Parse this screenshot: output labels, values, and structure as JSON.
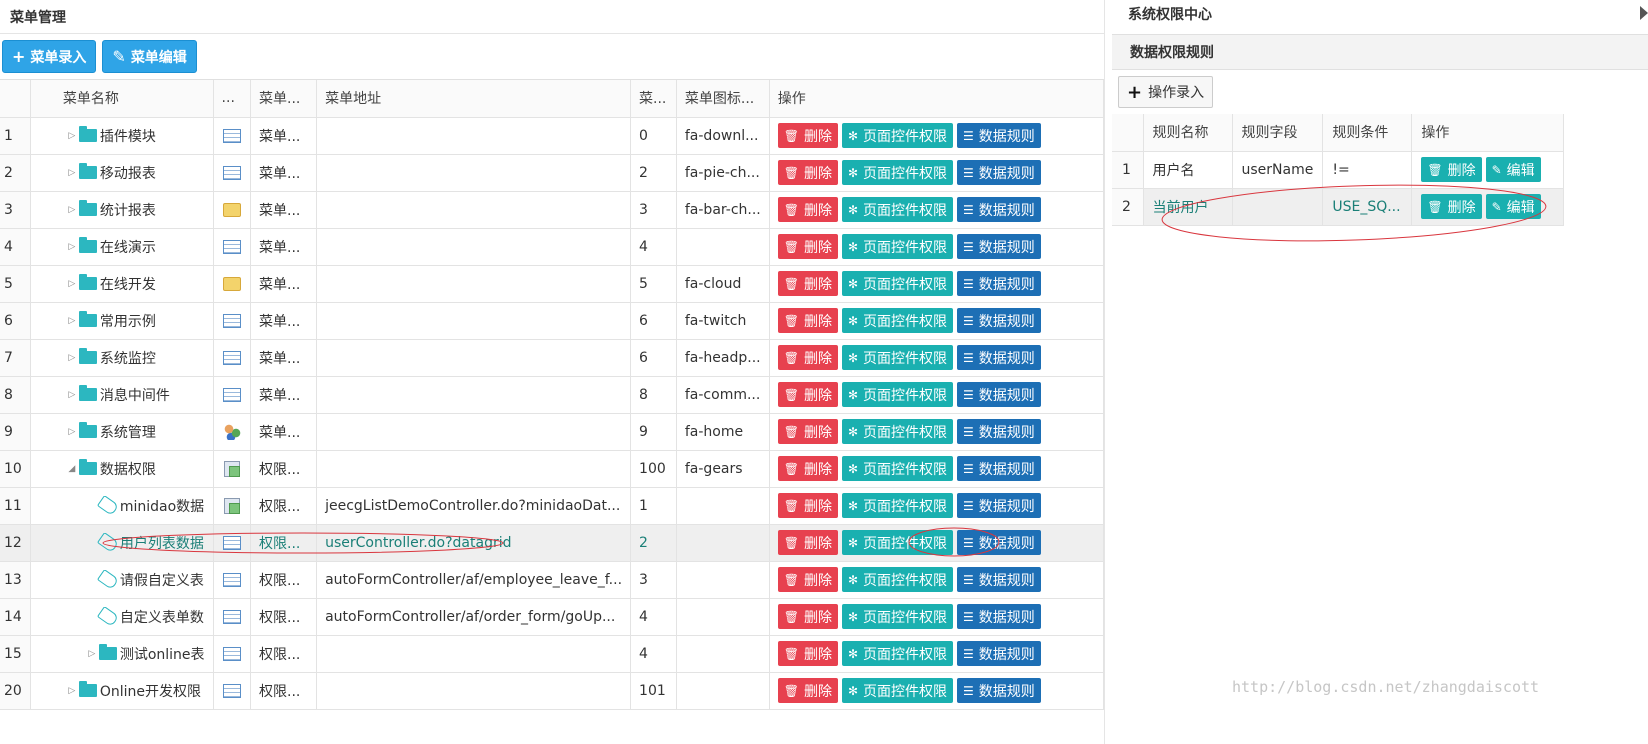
{
  "left_panel": {
    "title": "菜单管理",
    "toolbar": {
      "add_label": "菜单录入",
      "edit_label": "菜单编辑"
    },
    "columns": [
      "",
      "菜单名称",
      "...",
      "菜单...",
      "菜单地址",
      "菜...",
      "菜单图标...",
      "操作"
    ],
    "action_labels": {
      "delete": "删除",
      "page_perm": "页面控件权限",
      "data_rule": "数据规则"
    },
    "rows": [
      {
        "no": "1",
        "name": "插件模块",
        "level": 0,
        "expander": "▷",
        "node": "folder",
        "icon": "table",
        "type": "菜单...",
        "url": "",
        "order": "0",
        "icon_name": "fa-downl..."
      },
      {
        "no": "2",
        "name": "移动报表",
        "level": 0,
        "expander": "▷",
        "node": "folder",
        "icon": "table",
        "type": "菜单...",
        "url": "",
        "order": "2",
        "icon_name": "fa-pie-ch..."
      },
      {
        "no": "3",
        "name": "统计报表",
        "level": 0,
        "expander": "▷",
        "node": "folder",
        "icon": "folder",
        "type": "菜单...",
        "url": "",
        "order": "3",
        "icon_name": "fa-bar-ch..."
      },
      {
        "no": "4",
        "name": "在线演示",
        "level": 0,
        "expander": "▷",
        "node": "folder",
        "icon": "table",
        "type": "菜单...",
        "url": "",
        "order": "4",
        "icon_name": ""
      },
      {
        "no": "5",
        "name": "在线开发",
        "level": 0,
        "expander": "▷",
        "node": "folder",
        "icon": "folder",
        "type": "菜单...",
        "url": "",
        "order": "5",
        "icon_name": "fa-cloud"
      },
      {
        "no": "6",
        "name": "常用示例",
        "level": 0,
        "expander": "▷",
        "node": "folder",
        "icon": "table",
        "type": "菜单...",
        "url": "",
        "order": "6",
        "icon_name": "fa-twitch"
      },
      {
        "no": "7",
        "name": "系统监控",
        "level": 0,
        "expander": "▷",
        "node": "folder",
        "icon": "table",
        "type": "菜单...",
        "url": "",
        "order": "6",
        "icon_name": "fa-headp..."
      },
      {
        "no": "8",
        "name": "消息中间件",
        "level": 0,
        "expander": "▷",
        "node": "folder",
        "icon": "table",
        "type": "菜单...",
        "url": "",
        "order": "8",
        "icon_name": "fa-comm..."
      },
      {
        "no": "9",
        "name": "系统管理",
        "level": 0,
        "expander": "▷",
        "node": "folder",
        "icon": "users",
        "type": "菜单...",
        "url": "",
        "order": "9",
        "icon_name": "fa-home"
      },
      {
        "no": "10",
        "name": "数据权限",
        "level": 0,
        "expander": "◢",
        "node": "folder",
        "icon": "copy",
        "type": "权限...",
        "url": "",
        "order": "100",
        "icon_name": "fa-gears"
      },
      {
        "no": "11",
        "name": "minidao数据",
        "level": 1,
        "expander": "",
        "node": "tag",
        "icon": "copy",
        "type": "权限...",
        "url": "jeecgListDemoController.do?minidaoDat...",
        "order": "1",
        "icon_name": ""
      },
      {
        "no": "12",
        "name": "用户列表数据",
        "level": 1,
        "expander": "",
        "node": "tag",
        "icon": "table",
        "type": "权限...",
        "url": "userController.do?datagrid",
        "order": "2",
        "icon_name": "",
        "selected": true
      },
      {
        "no": "13",
        "name": "请假自定义表",
        "level": 1,
        "expander": "",
        "node": "tag",
        "icon": "table",
        "type": "权限...",
        "url": "autoFormController/af/employee_leave_f...",
        "order": "3",
        "icon_name": ""
      },
      {
        "no": "14",
        "name": "自定义表单数",
        "level": 1,
        "expander": "",
        "node": "tag",
        "icon": "table",
        "type": "权限...",
        "url": "autoFormController/af/order_form/goUp...",
        "order": "4",
        "icon_name": ""
      },
      {
        "no": "15",
        "name": "测试online表",
        "level": 1,
        "expander": "▷",
        "node": "folder",
        "icon": "table",
        "type": "权限...",
        "url": "",
        "order": "4",
        "icon_name": ""
      },
      {
        "no": "20",
        "name": "Online开发权限",
        "level": 0,
        "expander": "▷",
        "node": "folder",
        "icon": "table",
        "type": "权限...",
        "url": "",
        "order": "101",
        "icon_name": ""
      }
    ]
  },
  "right_panel": {
    "title": "系统权限中心",
    "subtitle": "数据权限规则",
    "add_label": "操作录入",
    "columns": [
      "",
      "规则名称",
      "规则字段",
      "规则条件",
      "操作"
    ],
    "action_labels": {
      "delete": "删除",
      "edit": "编辑"
    },
    "rows": [
      {
        "no": "1",
        "name": "用户名",
        "field": "userName",
        "condition": "!="
      },
      {
        "no": "2",
        "name": "当前用户",
        "field": "",
        "condition": "USE_SQ...",
        "selected": true
      }
    ]
  },
  "watermark": "http://blog.csdn.net/zhangdaiscott",
  "colors": {
    "primary": "#2fa4e7",
    "danger": "#e7414f",
    "teal": "#1ab0b0",
    "blue": "#1d6fb5",
    "annotation": "#d9363e"
  }
}
